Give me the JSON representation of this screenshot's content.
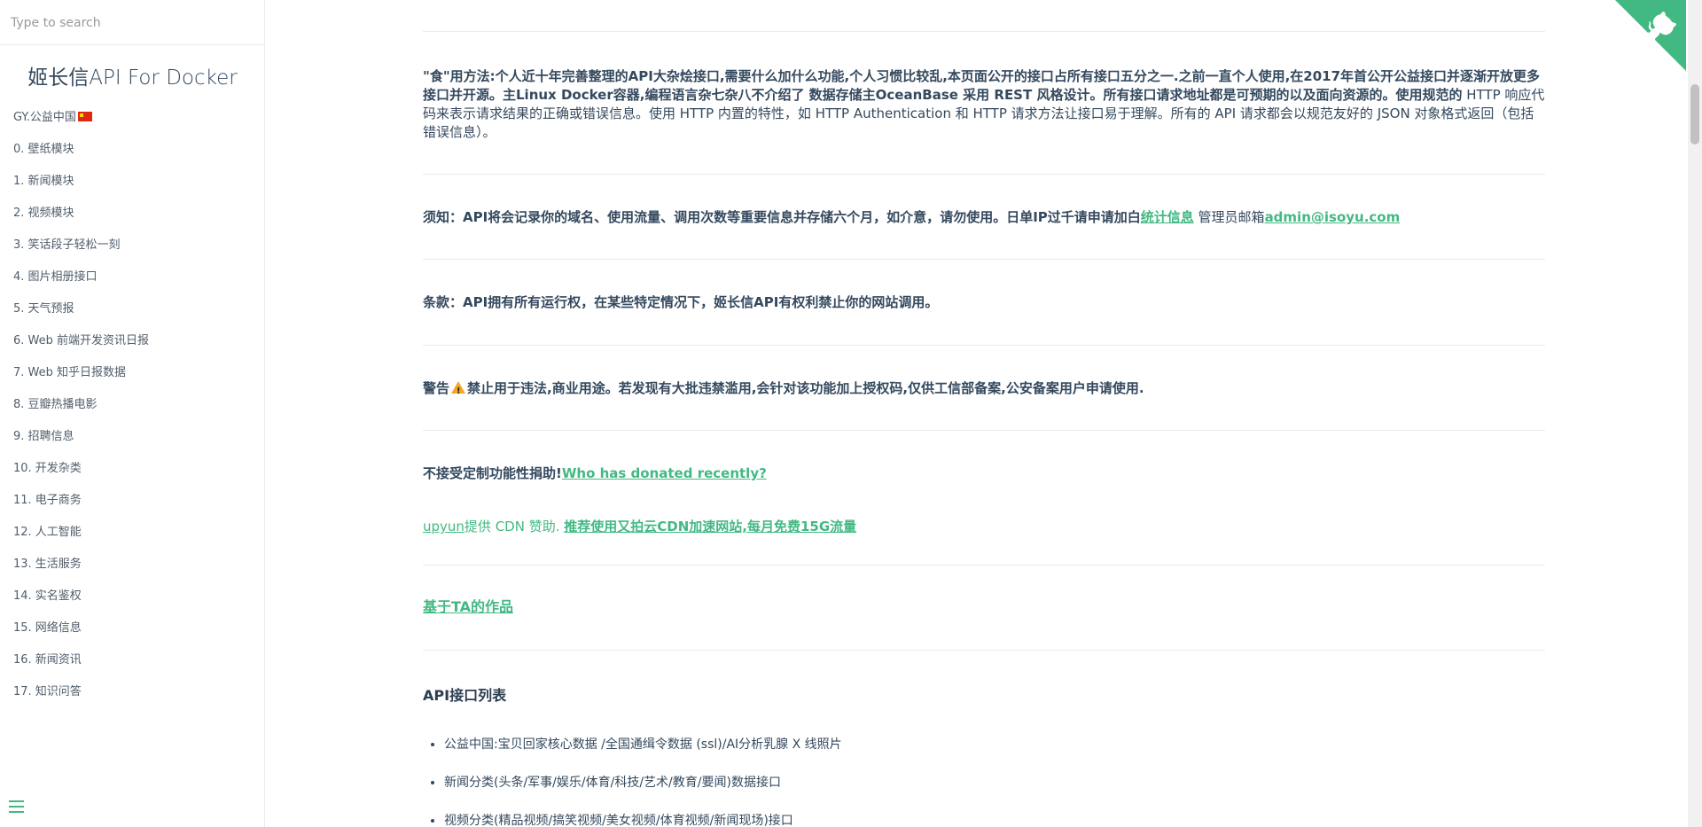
{
  "search": {
    "placeholder": "Type to search"
  },
  "sidebar": {
    "app_name": "姬长信API For Docker",
    "items": [
      {
        "label": "GY.公益中国"
      },
      {
        "label": "0. 壁纸模块"
      },
      {
        "label": "1. 新闻模块"
      },
      {
        "label": "2. 视频模块"
      },
      {
        "label": "3. 笑话段子轻松一刻"
      },
      {
        "label": "4. 图片相册接口"
      },
      {
        "label": "5. 天气预报"
      },
      {
        "label": "6. Web 前端开发资讯日报"
      },
      {
        "label": "7. Web 知乎日报数据"
      },
      {
        "label": "8. 豆瓣热播电影"
      },
      {
        "label": "9. 招聘信息"
      },
      {
        "label": "10. 开发杂类"
      },
      {
        "label": "11. 电子商务"
      },
      {
        "label": "12. 人工智能"
      },
      {
        "label": "13. 生活服务"
      },
      {
        "label": "14. 实名鉴权"
      },
      {
        "label": "15. 网络信息"
      },
      {
        "label": "16. 新闻资讯"
      },
      {
        "label": "17. 知识问答"
      }
    ]
  },
  "content": {
    "usage_bold": "\"食\"用方法:个人近十年完善整理的API大杂烩接口,需要什么加什么功能,个人习惯比较乱,本页面公开的接口占所有接口五分之一.之前一直个人使用,在2017年首公开公益接口并逐渐开放更多接口并开源。主Linux Docker容器,编程语言杂七杂八不介绍了 数据存储主OceanBase 采用 REST 风格设计。所有接口请求地址都是可预期的以及面向资源的。使用规范的",
    "usage_rest": "HTTP 响应代码来表示请求结果的正确或错误信息。使用 HTTP 内置的特性，如 HTTP Authentication 和 HTTP 请求方法让接口易于理解。所有的 API 请求都会以规范友好的 JSON 对象格式返回（包括错误信息）。",
    "notice_prefix": "须知：API将会记录你的域名、使用流量、调用次数等重要信息并存储六个月，如介意，请勿使用。日单IP过千请申请加白",
    "notice_link": "统计信息",
    "notice_admin": " 管理员邮箱",
    "notice_email": "admin@isoyu.com",
    "terms": "条款：API拥有所有运行权，在某些特定情况下，姬长信API有权利禁止你的网站调用。",
    "warning_label": "警告",
    "warning_text": "禁止用于违法,商业用途。若发现有大批违禁滥用,会针对该功能加上授权码,仅供工信部备案,公安备案用户申请使用.",
    "donate_text": "不接受定制功能性捐助!",
    "donate_link": "Who has donated recently?",
    "upyun_alt": "upyun",
    "upyun_text": "提供 CDN 赞助.",
    "upyun_link": "推荐使用又拍云CDN加速网站,每月免费15G流量",
    "works_link": "基于TA的作品",
    "api_list_title": "API接口列表",
    "api_list": [
      "公益中国:宝贝回家核心数据 /全国通缉令数据 (ssl)/AI分析乳腺 X 线照片",
      "新闻分类(头条/军事/娱乐/体育/科技/艺术/教育/要闻)数据接口",
      "视频分类(精品视频/搞笑视频/美女视频/体育视频/新闻现场)接口"
    ]
  }
}
